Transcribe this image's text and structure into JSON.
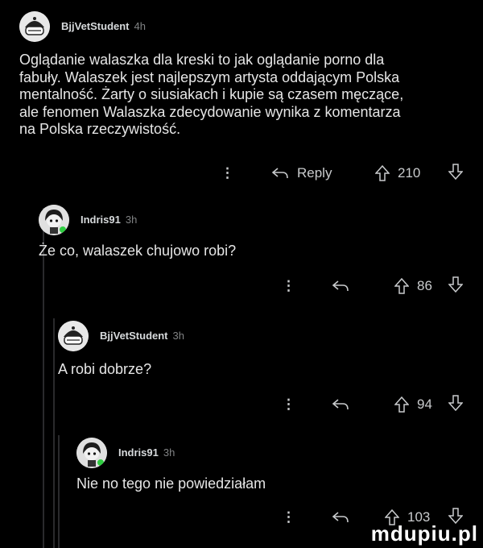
{
  "comments": [
    {
      "user": "BjjVetStudent",
      "age": "4h",
      "avatar": "snoo-avatar-helmet",
      "text_lines": [
        "Oglądanie walaszka dla kreski to jak oglądanie porno dla",
        "fabuły. Walaszek jest najlepszym artysta oddającym Polska",
        "mentalność. Żarty o siusiakach i kupie są czasem męczące,",
        "ale fenomen Walaszka zdecydowanie wynika z komentarza",
        "na Polska rzeczywistość."
      ],
      "reply_label": "Reply",
      "votes": "210"
    },
    {
      "user": "Indris91",
      "age": "3h",
      "avatar": "snoo-avatar-dark-hair",
      "text_lines": [
        "Że co, walaszek chujowo robi?"
      ],
      "reply_label": "",
      "votes": "86"
    },
    {
      "user": "BjjVetStudent",
      "age": "3h",
      "avatar": "snoo-avatar-helmet",
      "text_lines": [
        "A robi dobrze?"
      ],
      "reply_label": "",
      "votes": "94"
    },
    {
      "user": "Indris91",
      "age": "3h",
      "avatar": "snoo-avatar-dark-hair",
      "text_lines": [
        "Nie no tego nie powiedziałam"
      ],
      "reply_label": "",
      "votes": "103"
    }
  ],
  "watermark": "mdupiu.pl",
  "icons": {
    "more": "more-options-icon",
    "reply": "reply-arrow-icon",
    "upvote": "upvote-arrow-icon",
    "downvote": "downvote-arrow-icon"
  },
  "colors": {
    "background": "#000000",
    "text": "#d7dadc",
    "meta": "#818384"
  }
}
